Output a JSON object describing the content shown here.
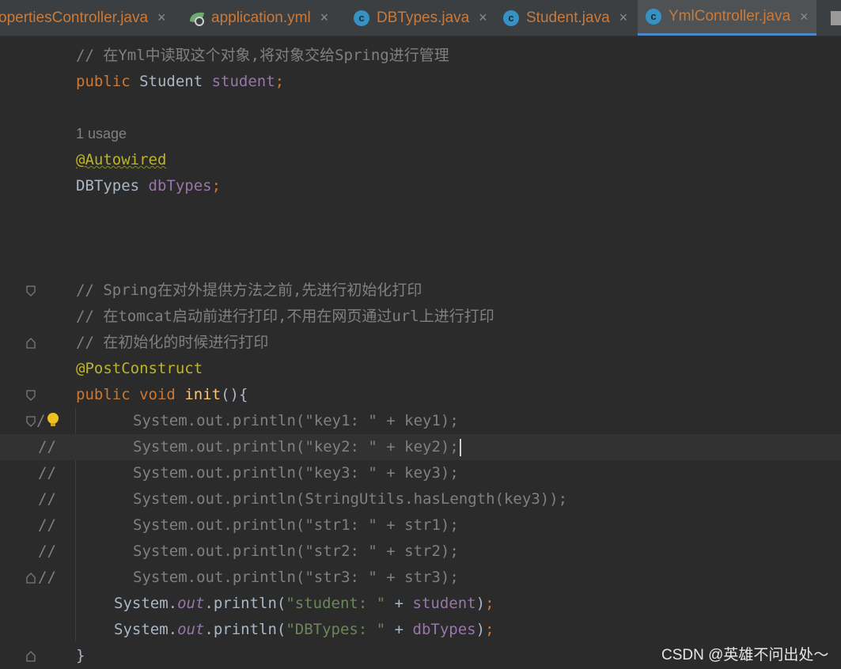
{
  "tabs": [
    {
      "label": "opertiesController.java",
      "icon": "none",
      "active": false
    },
    {
      "label": "application.yml",
      "icon": "spring-leaf",
      "active": false
    },
    {
      "label": "DBTypes.java",
      "icon": "class-c",
      "active": false
    },
    {
      "label": "Student.java",
      "icon": "class-c",
      "active": false
    },
    {
      "label": "YmlController.java",
      "icon": "class-c",
      "active": true
    }
  ],
  "close_glyph": "×",
  "class_icon_letter": "c",
  "code": {
    "l1_comment": "// 在Yml中读取这个对象,将对象交给Spring进行管理",
    "l2_kw": "public",
    "l2_type": " Student ",
    "l2_field": "student",
    "l2_semi": ";",
    "usage_hint": "1 usage",
    "l4_ann": "@Autowired",
    "l5_type": "DBTypes ",
    "l5_field": "dbTypes",
    "l5_semi": ";",
    "c1": "// Spring在对外提供方法之前,先进行初始化打印",
    "c2": "// 在tomcat启动前进行打印,不用在网页通过url上进行打印",
    "c3": "// 在初始化的时候进行打印",
    "ann2": "@PostConstruct",
    "m_kw1": "public",
    "m_kw2": "void",
    "m_name": "init",
    "m_tail": "(){",
    "commented_prefix": "//",
    "commented_lines": [
      "System.out.println(\"key1: \" + key1);",
      "System.out.println(\"key2: \" + key2);",
      "System.out.println(\"key3: \" + key3);",
      "System.out.println(StringUtils.hasLength(key3));",
      "System.out.println(\"str1: \" + str1);",
      "System.out.println(\"str2: \" + str2);",
      "System.out.println(\"str3: \" + str3);"
    ],
    "p1_sys": "System.",
    "p1_out": "out",
    "p1_call": ".println(",
    "p1_str": "\"student: \"",
    "p1_plus": " + ",
    "p1_field": "student",
    "p1_end": ")",
    "p1_semi": ";",
    "p2_str": "\"DBTypes: \"",
    "p2_field": "dbTypes",
    "close_brace": "}"
  },
  "watermark": "CSDN @英雄不问出处～",
  "colors": {
    "keyword": "#cc7832",
    "comment": "#808080",
    "field": "#9876aa",
    "annotation": "#bbb529",
    "string": "#6a8759",
    "method": "#ffc66d"
  }
}
